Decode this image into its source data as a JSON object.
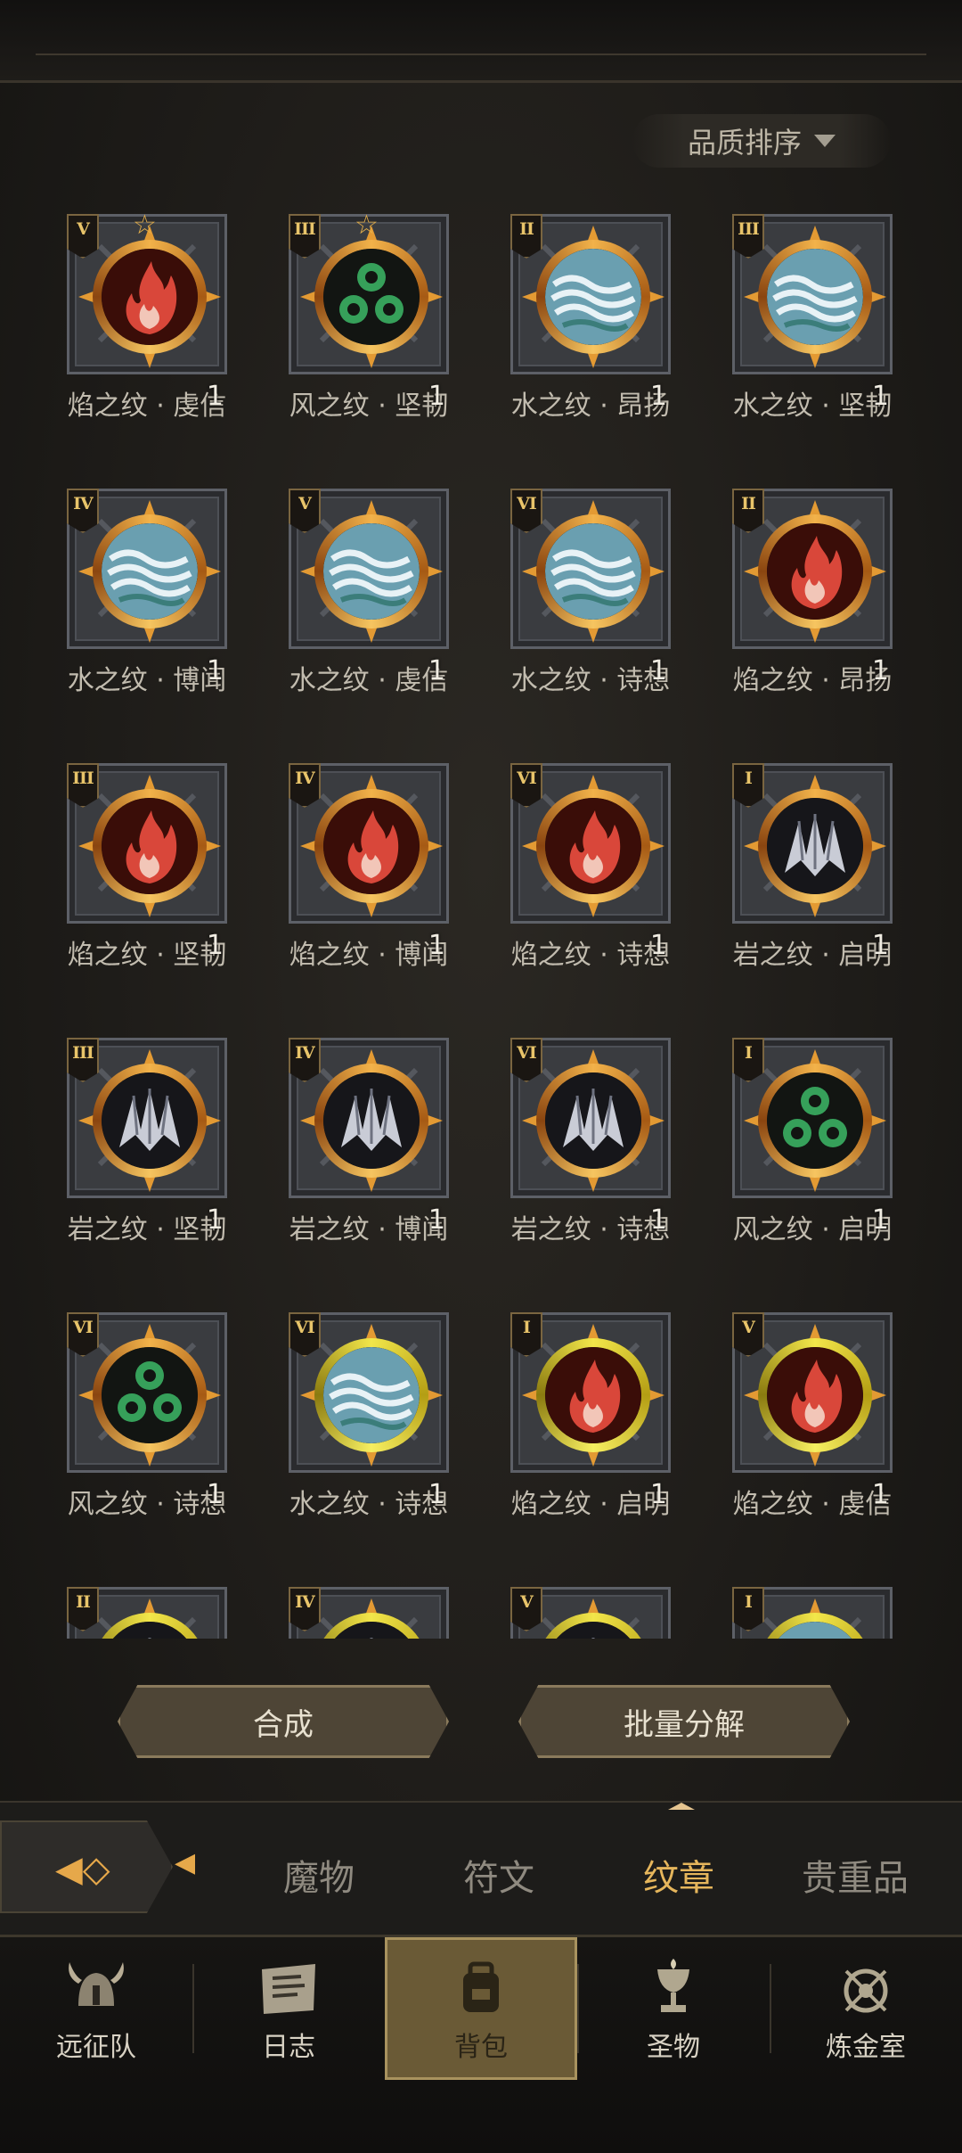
{
  "sort": {
    "label": "品质排序"
  },
  "items": [
    {
      "rank": "V",
      "star": true,
      "element": "fire",
      "count": "1",
      "name": "焰之纹 · 虔信",
      "ring": "orange"
    },
    {
      "rank": "III",
      "star": true,
      "element": "wind",
      "count": "1",
      "name": "风之纹 · 坚韧",
      "ring": "orange"
    },
    {
      "rank": "II",
      "star": false,
      "element": "water",
      "count": "1",
      "name": "水之纹 · 昂扬",
      "ring": "orange"
    },
    {
      "rank": "III",
      "star": false,
      "element": "water",
      "count": "1",
      "name": "水之纹 · 坚韧",
      "ring": "orange"
    },
    {
      "rank": "IV",
      "star": false,
      "element": "water",
      "count": "1",
      "name": "水之纹 · 博闻",
      "ring": "orange"
    },
    {
      "rank": "V",
      "star": false,
      "element": "water",
      "count": "1",
      "name": "水之纹 · 虔信",
      "ring": "orange"
    },
    {
      "rank": "VI",
      "star": false,
      "element": "water",
      "count": "1",
      "name": "水之纹 · 诗想",
      "ring": "orange"
    },
    {
      "rank": "II",
      "star": false,
      "element": "fire",
      "count": "1",
      "name": "焰之纹 · 昂扬",
      "ring": "orange"
    },
    {
      "rank": "III",
      "star": false,
      "element": "fire",
      "count": "1",
      "name": "焰之纹 · 坚韧",
      "ring": "orange"
    },
    {
      "rank": "IV",
      "star": false,
      "element": "fire",
      "count": "1",
      "name": "焰之纹 · 博闻",
      "ring": "orange"
    },
    {
      "rank": "VI",
      "star": false,
      "element": "fire",
      "count": "1",
      "name": "焰之纹 · 诗想",
      "ring": "orange"
    },
    {
      "rank": "I",
      "star": false,
      "element": "rock",
      "count": "1",
      "name": "岩之纹 · 启明",
      "ring": "orange"
    },
    {
      "rank": "III",
      "star": false,
      "element": "rock",
      "count": "1",
      "name": "岩之纹 · 坚韧",
      "ring": "orange"
    },
    {
      "rank": "IV",
      "star": false,
      "element": "rock",
      "count": "1",
      "name": "岩之纹 · 博闻",
      "ring": "orange"
    },
    {
      "rank": "VI",
      "star": false,
      "element": "rock",
      "count": "1",
      "name": "岩之纹 · 诗想",
      "ring": "orange"
    },
    {
      "rank": "I",
      "star": false,
      "element": "wind",
      "count": "1",
      "name": "风之纹 · 启明",
      "ring": "orange"
    },
    {
      "rank": "VI",
      "star": false,
      "element": "wind",
      "count": "1",
      "name": "风之纹 · 诗想",
      "ring": "orange"
    },
    {
      "rank": "VI",
      "star": false,
      "element": "water",
      "count": "1",
      "name": "水之纹 · 诗想",
      "ring": "yellow"
    },
    {
      "rank": "I",
      "star": false,
      "element": "fire",
      "count": "1",
      "name": "焰之纹 · 启明",
      "ring": "yellow"
    },
    {
      "rank": "V",
      "star": false,
      "element": "fire",
      "count": "1",
      "name": "焰之纹 · 虔信",
      "ring": "yellow"
    },
    {
      "rank": "II",
      "star": false,
      "element": "rock",
      "count": "",
      "name": "",
      "ring": "yellow"
    },
    {
      "rank": "IV",
      "star": false,
      "element": "rock",
      "count": "",
      "name": "",
      "ring": "yellow"
    },
    {
      "rank": "V",
      "star": false,
      "element": "rock",
      "count": "",
      "name": "",
      "ring": "yellow"
    },
    {
      "rank": "I",
      "star": false,
      "element": "water",
      "count": "",
      "name": "",
      "ring": "yellow"
    }
  ],
  "actions": {
    "compose": "合成",
    "batch_decompose": "批量分解"
  },
  "tabs": [
    {
      "label": "魔物",
      "active": false
    },
    {
      "label": "符文",
      "active": false
    },
    {
      "label": "纹章",
      "active": true
    },
    {
      "label": "贵重品",
      "active": false
    }
  ],
  "nav": [
    {
      "label": "远征队",
      "icon": "helmet-icon",
      "active": false
    },
    {
      "label": "日志",
      "icon": "journal-icon",
      "active": false
    },
    {
      "label": "背包",
      "icon": "backpack-icon",
      "active": true
    },
    {
      "label": "圣物",
      "icon": "chalice-icon",
      "active": false
    },
    {
      "label": "炼金室",
      "icon": "alchemy-icon",
      "active": false
    }
  ],
  "colors": {
    "accent": "#e6b65c",
    "ring_orange": "#f2b24a",
    "ring_yellow": "#f2e64a"
  }
}
